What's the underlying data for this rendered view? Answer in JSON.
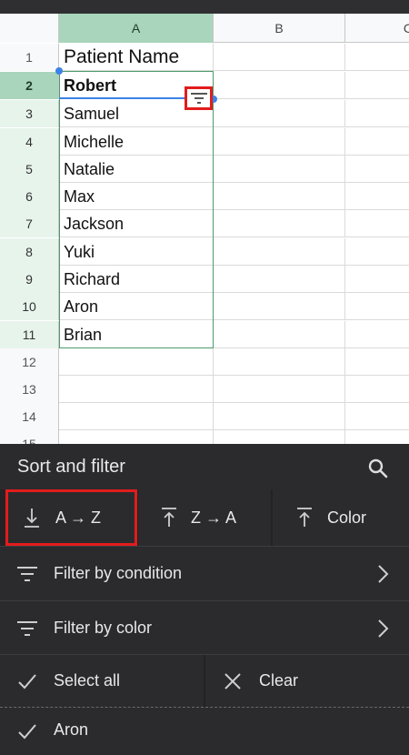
{
  "colors": {
    "accent_green": "#a8d5bb",
    "selection_blue": "#3b82e6",
    "highlight_red": "#e21c1c",
    "sheet_bg": "#2b2b2e"
  },
  "spreadsheet": {
    "columns": [
      "A",
      "B",
      "C"
    ],
    "rows": [
      {
        "num": "1",
        "a": "Patient Name"
      },
      {
        "num": "2",
        "a": "Robert"
      },
      {
        "num": "3",
        "a": "Samuel"
      },
      {
        "num": "4",
        "a": "Michelle"
      },
      {
        "num": "5",
        "a": "Natalie"
      },
      {
        "num": "6",
        "a": "Max"
      },
      {
        "num": "7",
        "a": "Jackson"
      },
      {
        "num": "8",
        "a": "Yuki"
      },
      {
        "num": "9",
        "a": "Richard"
      },
      {
        "num": "10",
        "a": "Aron"
      },
      {
        "num": "11",
        "a": "Brian"
      },
      {
        "num": "12",
        "a": ""
      },
      {
        "num": "13",
        "a": ""
      },
      {
        "num": "14",
        "a": ""
      },
      {
        "num": "15",
        "a": ""
      }
    ],
    "filter_icon": "filter-icon"
  },
  "sort_filter": {
    "title": "Sort and filter",
    "search_icon": "search-icon",
    "sort_az_label": "A → Z",
    "sort_za_label": "Z → A",
    "sort_color_label": "Color",
    "filter_condition_label": "Filter by condition",
    "filter_color_label": "Filter by color",
    "select_all_label": "Select all",
    "clear_label": "Clear",
    "values": [
      {
        "label": "Aron",
        "checked": true
      }
    ]
  }
}
